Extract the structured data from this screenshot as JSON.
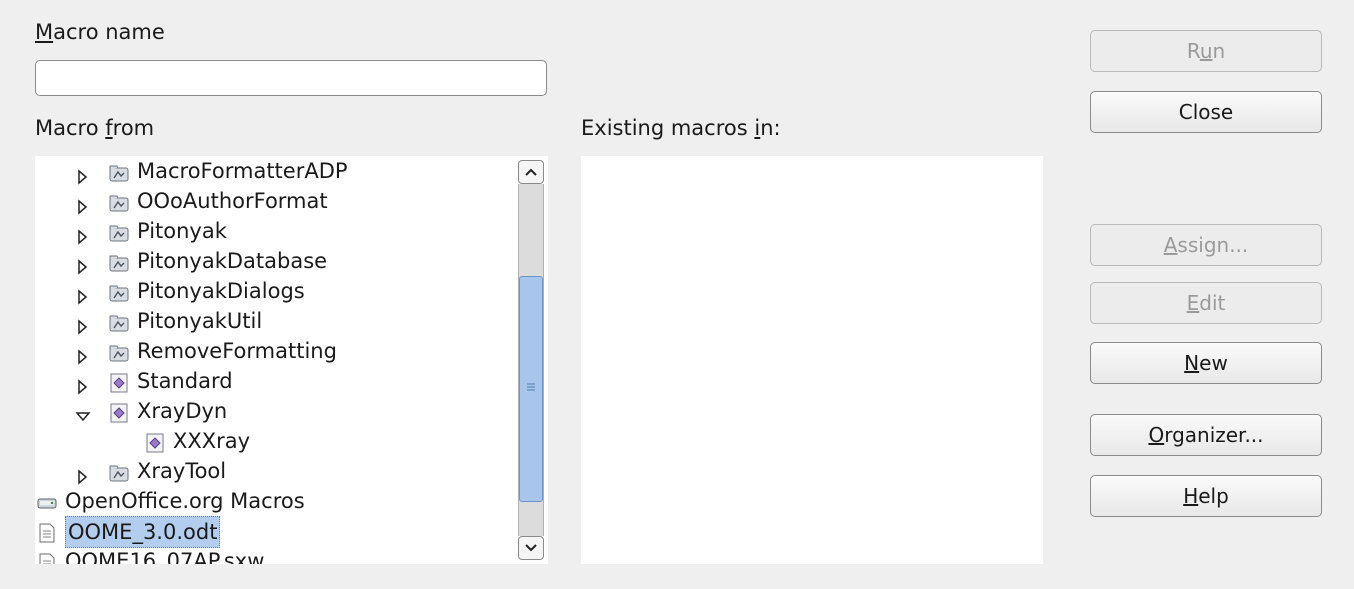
{
  "labels": {
    "macro_name_m": "M",
    "macro_name_rest": "acro name",
    "macro_from_pre": "Macro ",
    "macro_from_f": "f",
    "macro_from_post": "rom",
    "existing_pre": "Existing macros ",
    "existing_i": "i",
    "existing_post": "n:"
  },
  "macro_name_value": "",
  "tree": [
    {
      "label": "MacroFormatterADP",
      "icon": "library-folder-icon",
      "expand": "collapsed",
      "indent": 1
    },
    {
      "label": "OOoAuthorFormat",
      "icon": "library-folder-icon",
      "expand": "collapsed",
      "indent": 1
    },
    {
      "label": "Pitonyak",
      "icon": "library-folder-icon",
      "expand": "collapsed",
      "indent": 1
    },
    {
      "label": "PitonyakDatabase",
      "icon": "library-folder-icon",
      "expand": "collapsed",
      "indent": 1
    },
    {
      "label": "PitonyakDialogs",
      "icon": "library-folder-icon",
      "expand": "collapsed",
      "indent": 1
    },
    {
      "label": "PitonyakUtil",
      "icon": "library-folder-icon",
      "expand": "collapsed",
      "indent": 1
    },
    {
      "label": "RemoveFormatting",
      "icon": "library-folder-icon",
      "expand": "collapsed",
      "indent": 1
    },
    {
      "label": "Standard",
      "icon": "basic-library-icon",
      "expand": "collapsed",
      "indent": 1
    },
    {
      "label": "XrayDyn",
      "icon": "basic-library-icon",
      "expand": "expanded",
      "indent": 1
    },
    {
      "label": "XXXray",
      "icon": "basic-module-icon",
      "expand": "none",
      "indent": 2
    },
    {
      "label": "XrayTool",
      "icon": "library-folder-icon",
      "expand": "collapsed",
      "indent": 1
    },
    {
      "label": "OpenOffice.org Macros",
      "icon": "drive-icon",
      "expand": "collapsed",
      "indent": 0
    },
    {
      "label": "OOME_3.0.odt",
      "icon": "document-icon",
      "expand": "collapsed",
      "indent": 0,
      "selected": true
    },
    {
      "label": "OOME16_07AP.sxw",
      "icon": "document-icon",
      "expand": "collapsed",
      "indent": 0
    }
  ],
  "buttons": {
    "run": {
      "pre": "R",
      "u": "u",
      "post": "n",
      "enabled": false
    },
    "close": {
      "pre": "Close",
      "u": "",
      "post": "",
      "enabled": true
    },
    "assign": {
      "pre": "",
      "u": "A",
      "post": "ssign...",
      "enabled": false
    },
    "edit": {
      "pre": "",
      "u": "E",
      "post": "dit",
      "enabled": false
    },
    "new": {
      "pre": "",
      "u": "N",
      "post": "ew",
      "enabled": true
    },
    "organizer": {
      "pre": "",
      "u": "O",
      "post": "rganizer...",
      "enabled": true
    },
    "help": {
      "pre": "",
      "u": "H",
      "post": "elp",
      "enabled": true
    }
  }
}
